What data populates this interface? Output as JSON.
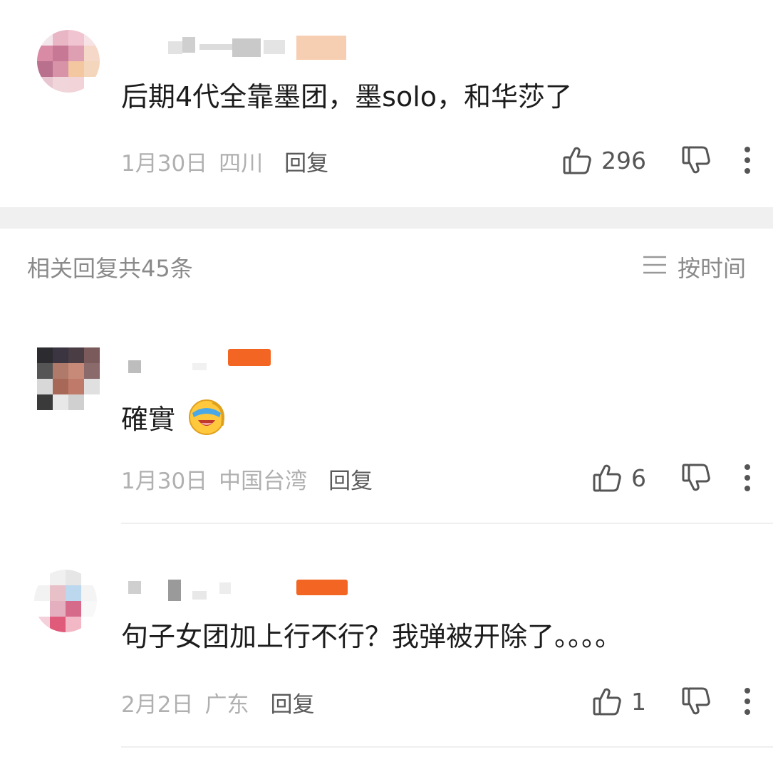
{
  "top_comment": {
    "text": "后期4代全靠墨团，墨solo，和华莎了",
    "date": "1月30日",
    "location": "四川",
    "reply_label": "回复",
    "likes": "296"
  },
  "related": {
    "title": "相关回复共45条",
    "sort_label": "按时间"
  },
  "replies": [
    {
      "text": "確實",
      "emoji": "laughing-cry-emoji",
      "date": "1月30日",
      "location": "中国台湾",
      "reply_label": "回复",
      "likes": "6"
    },
    {
      "text": "句子女团加上行不行？我弹被开除了。。。。",
      "date": "2月2日",
      "location": "广东",
      "reply_label": "回复",
      "likes": "1"
    }
  ],
  "icons": {
    "like": "thumb-up-icon",
    "dislike": "thumb-down-icon",
    "more": "more-vertical-icon",
    "sort": "menu-lines-icon"
  },
  "colors": {
    "meta_gray": "#b0b0b0",
    "reply_gray": "#5a5a5a",
    "section_bg": "#f0f0f0",
    "badge_orange": "#f26522"
  }
}
